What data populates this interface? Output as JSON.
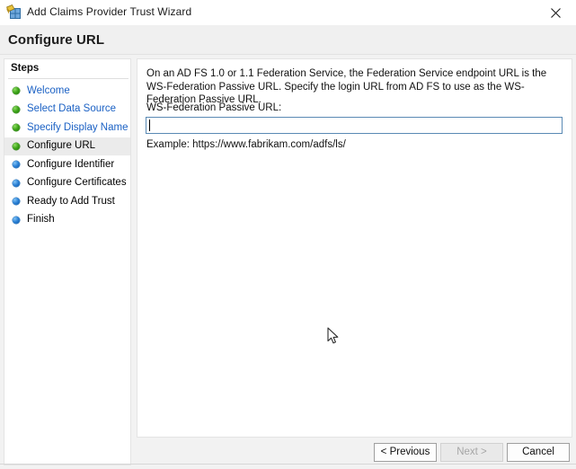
{
  "window": {
    "title": "Add Claims Provider Trust Wizard",
    "icon": "adfs-claims-provider-icon",
    "close_label": "✕"
  },
  "page": {
    "heading": "Configure URL"
  },
  "sidebar": {
    "header": "Steps",
    "items": [
      {
        "label": "Welcome",
        "state": "done",
        "link": true,
        "current": false
      },
      {
        "label": "Select Data Source",
        "state": "done",
        "link": true,
        "current": false
      },
      {
        "label": "Specify Display Name",
        "state": "done",
        "link": true,
        "current": false
      },
      {
        "label": "Configure URL",
        "state": "done",
        "link": false,
        "current": true
      },
      {
        "label": "Configure Identifier",
        "state": "pending",
        "link": false,
        "current": false
      },
      {
        "label": "Configure Certificates",
        "state": "pending",
        "link": false,
        "current": false
      },
      {
        "label": "Ready to Add Trust",
        "state": "pending",
        "link": false,
        "current": false
      },
      {
        "label": "Finish",
        "state": "pending",
        "link": false,
        "current": false
      }
    ]
  },
  "main": {
    "intro": "On an AD FS 1.0 or 1.1 Federation Service, the Federation Service endpoint URL is the WS-Federation Passive URL.  Specify the login URL from AD FS to use as the WS-Federation Passive URL.",
    "url_label": "WS-Federation Passive URL:",
    "url_value": "",
    "url_placeholder": "",
    "example": "Example: https://www.fabrikam.com/adfs/ls/"
  },
  "buttons": {
    "previous": "< Previous",
    "next": "Next >",
    "cancel": "Cancel"
  },
  "colors": {
    "step_done": "#3da318",
    "step_pending": "#2a7fd4",
    "link": "#1b61c4",
    "input_border": "#5a8ab4",
    "panel_bg": "#f2f2f2"
  }
}
